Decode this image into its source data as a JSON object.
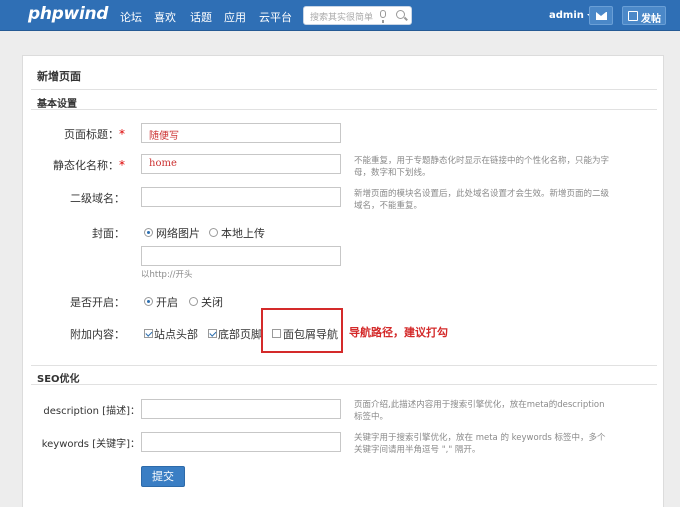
{
  "app": {
    "logo": "phpwind"
  },
  "nav": [
    "论坛",
    "喜欢",
    "话题",
    "应用",
    "云平台"
  ],
  "search": {
    "placeholder": "搜索其实很简单"
  },
  "user": {
    "name": "admin"
  },
  "actions": {
    "post_label": "发帖"
  },
  "page": {
    "title": "新增页面",
    "basic_section": "基本设置",
    "seo_section": "SEO优化"
  },
  "form": {
    "page_title": {
      "label": "页面标题：",
      "required": "*",
      "value": "随便写"
    },
    "static_name": {
      "label": "静态化名称：",
      "required": "*",
      "value": "home",
      "hint": "不能重复，用于专题静态化时显示在链接中的个性化名称，只能为字母，数字和下划线。"
    },
    "subdomain": {
      "label": "二级域名：",
      "value": "",
      "hint": "新增页面的模块名设置后，此处域名设置才会生效。新增页面的二级域名，不能重复。"
    },
    "cover": {
      "label": "封面：",
      "options": [
        "网络图片",
        "本地上传"
      ],
      "selected": "网络图片",
      "url_value": "",
      "url_hint": "以http://开头"
    },
    "enabled": {
      "label": "是否开启：",
      "options": [
        "开启",
        "关闭"
      ],
      "selected": "开启"
    },
    "extra": {
      "label": "附加内容：",
      "options": [
        {
          "label": "站点头部",
          "checked": true
        },
        {
          "label": "底部页脚",
          "checked": true
        },
        {
          "label": "面包屑导航",
          "checked": false
        }
      ]
    },
    "annotation": "导航路径，建议打勾",
    "description": {
      "label": "description [描述]：",
      "value": "",
      "hint": "页面介绍,此描述内容用于搜索引擎优化，放在meta的description标签中。"
    },
    "keywords": {
      "label": "keywords [关键字]：",
      "value": "",
      "hint": "关键字用于搜索引擎优化，放在 meta 的 keywords 标签中，多个关键字间请用半角逗号 \",\" 隔开。"
    },
    "submit_label": "提交"
  },
  "colors": {
    "topbar": "#2f6fb5",
    "accent": "#3a7ec4",
    "annotation": "#d42a2a"
  }
}
